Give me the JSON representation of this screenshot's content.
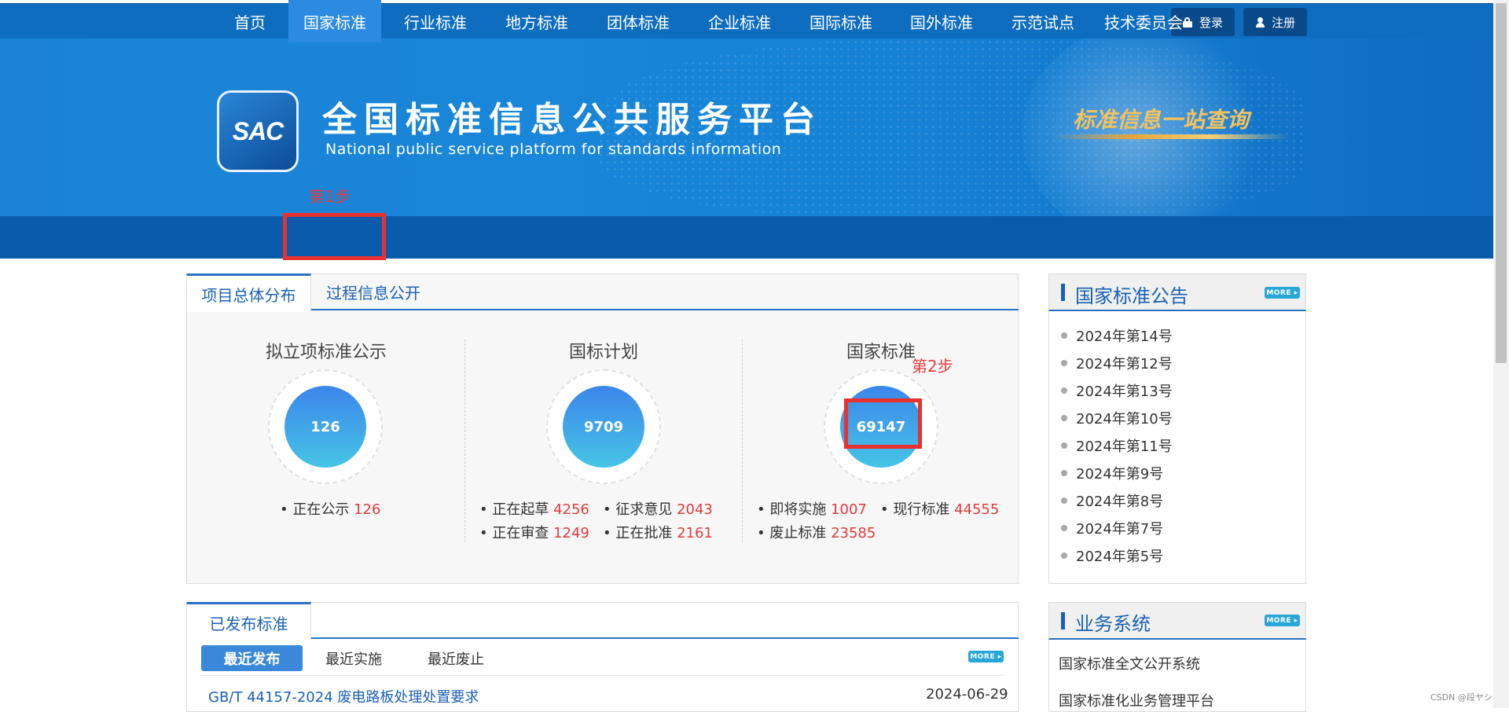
{
  "header": {
    "login_label": "登录",
    "register_label": "注册",
    "logo_text": "SAC",
    "title_cn": "全国标准信息公共服务平台",
    "title_en": "National public service platform  for standards information",
    "slogan": "标准信息一站查询"
  },
  "nav": {
    "items": [
      "首页",
      "国家标准",
      "行业标准",
      "地方标准",
      "团体标准",
      "企业标准",
      "国际标准",
      "国外标准",
      "示范试点",
      "技术委员会"
    ],
    "active_index": 1
  },
  "annotations": {
    "step1": "第1步",
    "step2": "第2步"
  },
  "overview": {
    "tabs": [
      "项目总体分布",
      "过程信息公开"
    ],
    "columns": [
      {
        "title": "拟立项标准公示",
        "total": "126",
        "stats": [
          {
            "label": "正在公示",
            "value": "126"
          }
        ]
      },
      {
        "title": "国标计划",
        "total": "9709",
        "stats": [
          {
            "label": "正在起草",
            "value": "4256"
          },
          {
            "label": "征求意见",
            "value": "2043"
          },
          {
            "label": "正在审查",
            "value": "1249"
          },
          {
            "label": "正在批准",
            "value": "2161"
          }
        ]
      },
      {
        "title": "国家标准",
        "total": "69147",
        "stats": [
          {
            "label": "即将实施",
            "value": "1007"
          },
          {
            "label": "现行标准",
            "value": "44555"
          },
          {
            "label": "废止标准",
            "value": "23585"
          }
        ]
      }
    ]
  },
  "published": {
    "tab": "已发布标准",
    "subtabs": [
      "最近发布",
      "最近实施",
      "最近废止"
    ],
    "more_label": "MORE ▸",
    "items": [
      {
        "title": "GB/T 44157-2024 废电路板处理处置要求",
        "date": "2024-06-29"
      }
    ]
  },
  "announcements": {
    "title": "国家标准公告",
    "more_label": "MORE ▸",
    "items": [
      "2024年第14号",
      "2024年第12号",
      "2024年第13号",
      "2024年第10号",
      "2024年第11号",
      "2024年第9号",
      "2024年第8号",
      "2024年第7号",
      "2024年第5号"
    ]
  },
  "systems": {
    "title": "业务系统",
    "more_label": "MORE ▸",
    "items": [
      "国家标准全文公开系统",
      "国家标准化业务管理平台"
    ]
  },
  "watermark": "CSDN @段ヤシ",
  "colors": {
    "brand_blue": "#0a5bab",
    "accent_red": "#e8312f",
    "number_red": "#e03c3c"
  }
}
